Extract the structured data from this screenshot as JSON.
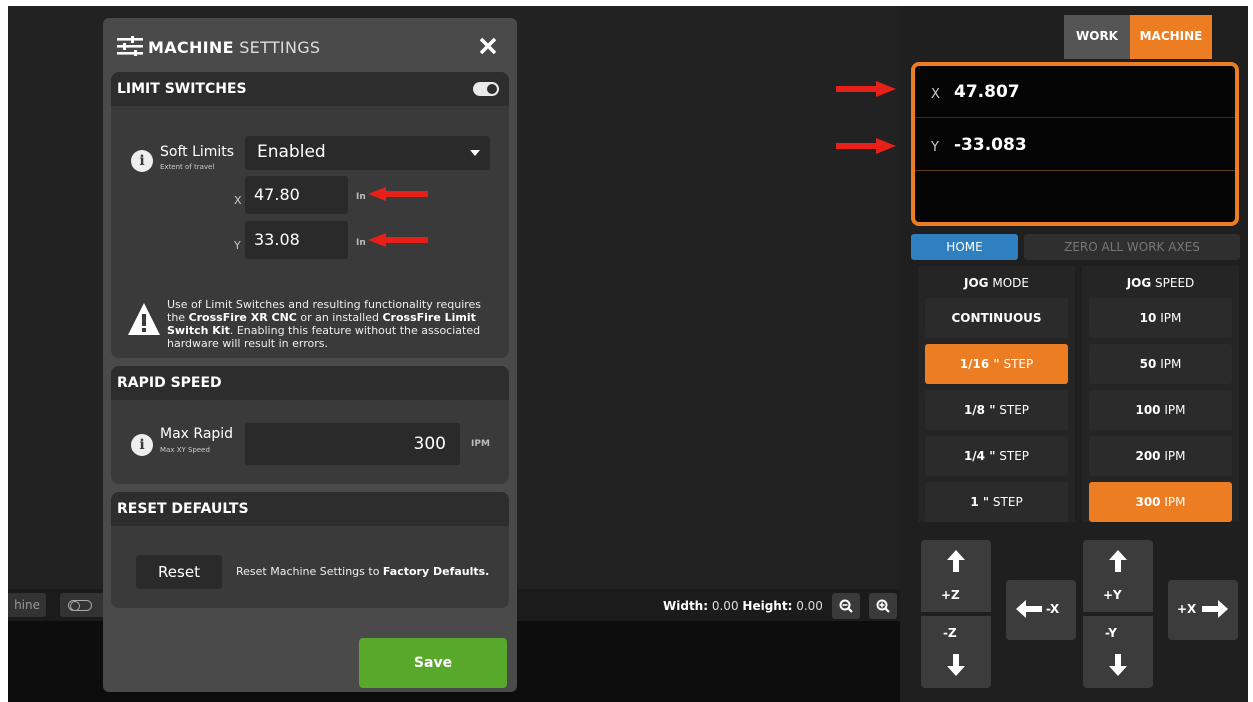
{
  "canvas": {
    "machine_chip_label": "hine",
    "dims": {
      "width_label": "Width:",
      "width_value": "0.00",
      "height_label": "Height:",
      "height_value": "0.00"
    }
  },
  "modal": {
    "title_bold": "MACHINE",
    "title_light": "SETTINGS",
    "limit_switches": {
      "header": "LIMIT SWITCHES",
      "soft_limits_label": "Soft Limits",
      "soft_limits_sub": "Extent of travel",
      "soft_limits_value": "Enabled",
      "x_label": "X",
      "x_value": "47.80",
      "y_label": "Y",
      "y_value": "33.08",
      "unit": "In",
      "warning_1": "Use of Limit Switches and resulting functionality requires the ",
      "warning_b1": "CrossFire XR CNC",
      "warning_2": " or an installed ",
      "warning_b2": "CrossFire Limit Switch Kit",
      "warning_3": ". Enabling this feature without the associated hardware will result in errors."
    },
    "rapid_speed": {
      "header": "RAPID SPEED",
      "label": "Max Rapid",
      "sub": "Max XY Speed",
      "value": "300",
      "unit": "IPM"
    },
    "reset_defaults": {
      "header": "RESET DEFAULTS",
      "button": "Reset",
      "text": "Reset Machine Settings to ",
      "text_bold": "Factory Defaults."
    },
    "save_label": "Save"
  },
  "right_panel": {
    "tabs": [
      {
        "label": "WORK"
      },
      {
        "label": "MACHINE"
      }
    ],
    "coords": [
      {
        "axis": "X",
        "value": "47.807"
      },
      {
        "axis": "Y",
        "value": "-33.083"
      }
    ],
    "home_label": "HOME",
    "zero_label": "ZERO ALL WORK AXES",
    "jog_mode": {
      "head_bold": "JOG",
      "head_rest": " MODE",
      "items": [
        {
          "bold": "CONTINUOUS",
          "rest": ""
        },
        {
          "bold": "1/16 \"",
          "rest": " STEP"
        },
        {
          "bold": "1/8 \"",
          "rest": " STEP"
        },
        {
          "bold": "1/4 \"",
          "rest": " STEP"
        },
        {
          "bold": "1 \"",
          "rest": " STEP"
        }
      ]
    },
    "jog_speed": {
      "head_bold": "JOG",
      "head_rest": " SPEED",
      "items": [
        {
          "bold": "10",
          "rest": " IPM"
        },
        {
          "bold": "50",
          "rest": " IPM"
        },
        {
          "bold": "100",
          "rest": " IPM"
        },
        {
          "bold": "200",
          "rest": " IPM"
        },
        {
          "bold": "300",
          "rest": " IPM"
        }
      ]
    },
    "jog_dir": {
      "plus_z": "+Z",
      "minus_z": "-Z",
      "minus_x": "-X",
      "plus_y": "+Y",
      "minus_y": "-Y",
      "plus_x": "+X"
    }
  },
  "colors": {
    "accent_orange": "#ed7d22",
    "home_blue": "#2f80c0",
    "save_green": "#58a82b",
    "annotation_red": "#e8201a"
  }
}
